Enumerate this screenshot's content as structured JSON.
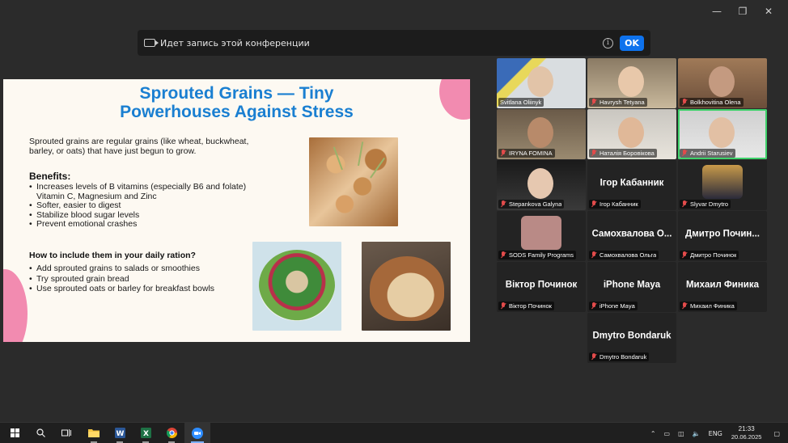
{
  "window": {
    "minimize": "—",
    "restore": "❐",
    "close": "✕"
  },
  "banner": {
    "text": "Идет запись этой конференции",
    "ok": "OK"
  },
  "slide": {
    "title_line1": "Sprouted Grains — Tiny",
    "title_line2": "Powerhouses Against Stress",
    "intro": "Sprouted grains are regular grains (like wheat, buckwheat, barley, or oats) that have just begun to grow.",
    "benefits_heading": "Benefits:",
    "benefits": [
      "Increases levels of B vitamins (especially B6 and folate) Vitamin C, Magnesium and Zinc",
      "Softer, easier to digest",
      "Stabilize blood sugar levels",
      "Prevent emotional crashes"
    ],
    "howto_heading": "How to include them in your daily ration?",
    "howto": [
      "Add sprouted grains to salads or smoothies",
      "Try sprouted grain bread",
      "Use sprouted oats or barley for breakfast bowls"
    ]
  },
  "participants": [
    {
      "name": "Svitlana Oliinyk",
      "muted": false
    },
    {
      "name": "Havrysh Tetyana",
      "muted": true
    },
    {
      "name": "Bolkhovitina Olena",
      "muted": true
    },
    {
      "name": "IRYNA FOMINA",
      "muted": true
    },
    {
      "name": "Наталія Боровікова",
      "muted": true
    },
    {
      "name": "Andrii Starusiev",
      "muted": true,
      "active": true
    },
    {
      "name": "Stepankova Galyna",
      "muted": true
    },
    {
      "name": "Ігор Кабанник",
      "muted": true,
      "display": "Ігор Кабанник"
    },
    {
      "name": "Slyvar Dmytro",
      "muted": true
    },
    {
      "name": "SODS Family Programs",
      "muted": true
    },
    {
      "name": "Самохвалова Ольга",
      "muted": true,
      "display": "Самохвалова О..."
    },
    {
      "name": "Дмитро Починок",
      "muted": true,
      "display": "Дмитро Почин..."
    },
    {
      "name": "Віктор Починок",
      "muted": true,
      "display": "Віктор Починок"
    },
    {
      "name": "iPhone Maya",
      "muted": true,
      "display": "iPhone Maya"
    },
    {
      "name": "Михаил Финика",
      "muted": true,
      "display": "Михаил Финика"
    },
    {
      "name": "Dmytro Bondaruk",
      "muted": true,
      "display": "Dmytro Bondaruk"
    }
  ],
  "taskbar": {
    "lang": "ENG",
    "time": "21:33",
    "date": "20.06.2025"
  },
  "colors": {
    "accent": "#0e72ed",
    "title_blue": "#1a7fd1",
    "pink": "#f28bb0",
    "active_border": "#3fd26b",
    "mute_red": "#e24b4b"
  }
}
